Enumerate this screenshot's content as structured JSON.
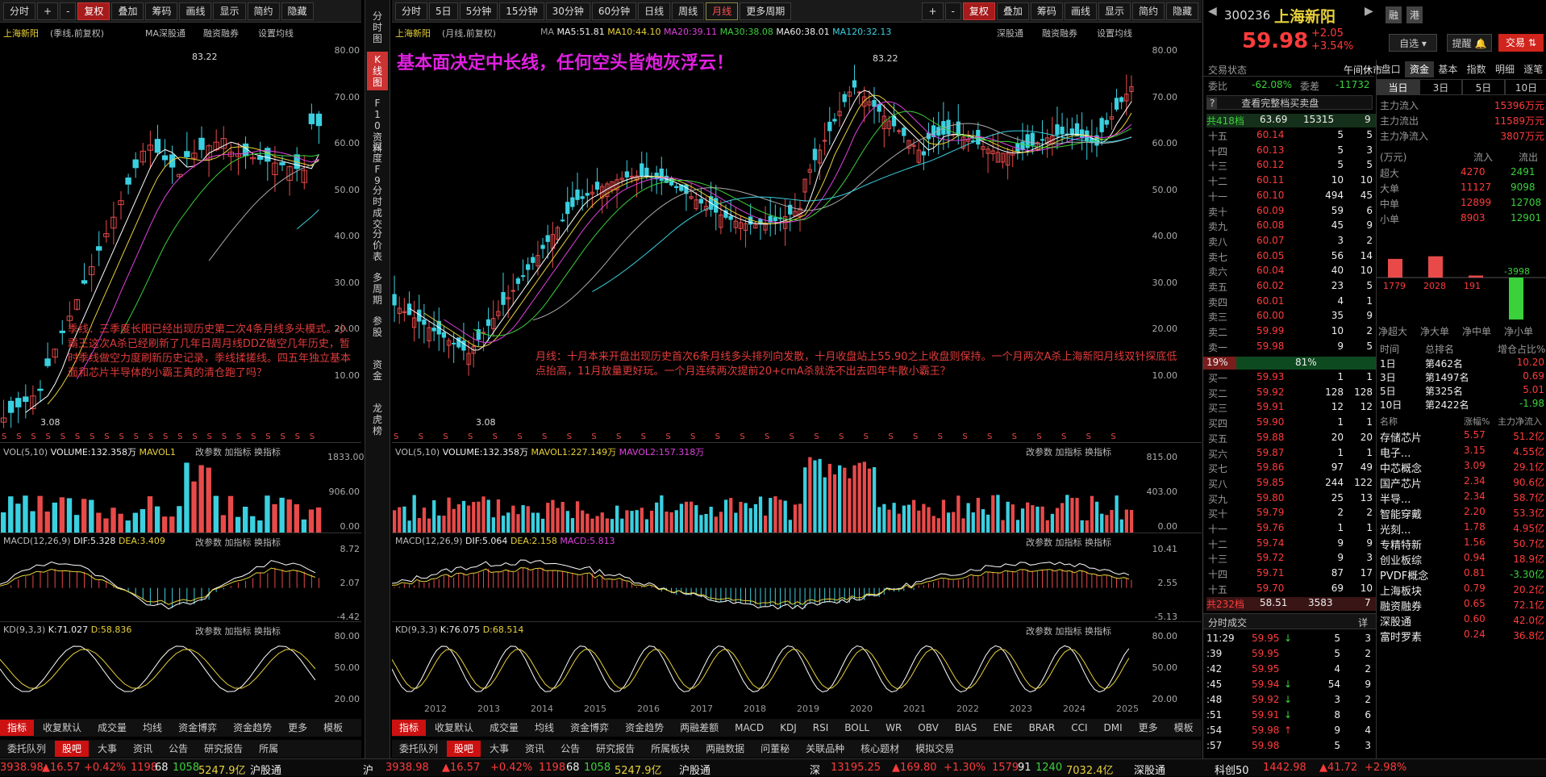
{
  "left": {
    "toolbar": [
      "分时",
      "+",
      "-",
      "复权",
      "叠加",
      "筹码",
      "画线",
      "显示",
      "简约",
      "隐藏"
    ],
    "title": "上海新阳",
    "period": "(季线,前复权)",
    "ma_label": "MA深股通",
    "financing": "融资融券",
    "settings": "设置均线",
    "yaxis": [
      "80.00",
      "70.00",
      "60.00",
      "50.00",
      "40.00",
      "30.00",
      "20.00",
      "10.00"
    ],
    "high": "83.22",
    "low": "3.08",
    "annot": "季线：三季度长阳已经出现历史第二次4条月线多头模式。小霸王这次A杀已经刷新了几年日周月线DDZ做空几年历史，暂时季线做空力度刷新历史记录，季线揉搓线。四五年独立基本面和芯片半导体的小霸王真的清仓跑了吗？",
    "vol": {
      "label": "VOL(5,10)",
      "v": "VOLUME:132.358万",
      "ma": "MAVOL1",
      "tools": [
        "改参数",
        "加指标",
        "换指标"
      ],
      "yaxis": [
        "1833.00",
        "906.00",
        "0.00"
      ]
    },
    "macd": {
      "label": "MACD(12,26,9)",
      "dif": "DIF:5.328",
      "dea": "DEA:3.409",
      "tools": [
        "改参数",
        "加指标",
        "换指标"
      ],
      "yaxis": [
        "8.72",
        "2.07",
        "-4.42"
      ]
    },
    "kd": {
      "label": "KD(9,3,3)",
      "k": "K:71.027",
      "d": "D:58.836",
      "tools": [
        "改参数",
        "加指标",
        "换指标"
      ],
      "yaxis": [
        "80.00",
        "50.00",
        "20.00"
      ]
    },
    "ind_tabs": [
      "指标",
      "收复默认",
      "成交量",
      "均线",
      "资金博弈",
      "资金趋势",
      "更多",
      "模板"
    ],
    "bottom_tabs": [
      "委托队列",
      "股吧",
      "大事",
      "资讯",
      "公告",
      "研究报告",
      "所属"
    ]
  },
  "vtabs": [
    "分时图",
    "K线图",
    "F10资料",
    "深度F9",
    "分时成交",
    "分价表",
    "多周期",
    "参股",
    "资金",
    "龙虎榜"
  ],
  "main": {
    "toolbar": [
      "分时",
      "5日",
      "5分钟",
      "15分钟",
      "30分钟",
      "60分钟",
      "日线",
      "周线",
      "月线",
      "更多周期"
    ],
    "tools": [
      "+",
      "-",
      "复权",
      "叠加",
      "筹码",
      "画线",
      "显示",
      "简约",
      "隐藏"
    ],
    "title": "上海新阳",
    "period": "(月线,前复权)",
    "ma": {
      "label": "MA",
      "ma5": "MA5:51.81",
      "ma10": "MA10:44.10",
      "ma20": "MA20:39.11",
      "ma30": "MA30:38.08",
      "ma60": "MA60:38.01",
      "ma120": "MA120:32.13"
    },
    "sg": "深股通",
    "financing": "融资融券",
    "settings": "设置均线",
    "headline": "基本面决定中长线，任何空头皆炮灰浮云！",
    "annot": "月线：十月本来开盘出现历史首次6条月线多头排列向发散，十月收盘站上55.90之上收盘则保持。一个月两次A杀上海新阳月线双针探底低点抬高，11月放量更好玩。一个月连续两次提前20+cmA杀就洗不出去四年牛散小霸王？",
    "high": "83.22",
    "low": "3.08",
    "yaxis": [
      "80.00",
      "70.00",
      "60.00",
      "50.00",
      "40.00",
      "30.00",
      "20.00",
      "10.00"
    ],
    "vol": {
      "label": "VOL(5,10)",
      "v": "VOLUME:132.358万",
      "ma1": "MAVOL1:227.149万",
      "ma2": "MAVOL2:157.318万",
      "tools": [
        "改参数",
        "加指标",
        "换指标"
      ],
      "yaxis": [
        "815.00",
        "403.00",
        "0.00"
      ]
    },
    "macd": {
      "label": "MACD(12,26,9)",
      "dif": "DIF:5.064",
      "dea": "DEA:2.158",
      "macd": "MACD:5.813",
      "tools": [
        "改参数",
        "加指标",
        "换指标"
      ],
      "yaxis": [
        "10.41",
        "2.55",
        "-5.13"
      ]
    },
    "kd": {
      "label": "KD(9,3,3)",
      "k": "K:76.075",
      "d": "D:68.514",
      "tools": [
        "改参数",
        "加指标",
        "换指标"
      ],
      "yaxis": [
        "80.00",
        "50.00",
        "20.00"
      ]
    },
    "years": [
      "2012",
      "2013",
      "2014",
      "2015",
      "2016",
      "2017",
      "2018",
      "2019",
      "2020",
      "2021",
      "2022",
      "2023",
      "2024",
      "2025"
    ],
    "ind_tabs": [
      "指标",
      "收复默认",
      "成交量",
      "均线",
      "资金博弈",
      "资金趋势",
      "两融差额",
      "MACD",
      "KDJ",
      "RSI",
      "BOLL",
      "WR",
      "OBV",
      "BIAS",
      "ENE",
      "BRAR",
      "CCI",
      "DMI",
      "更多",
      "模板"
    ],
    "bottom_tabs": [
      "委托队列",
      "股吧",
      "大事",
      "资讯",
      "公告",
      "研究报告",
      "所属板块",
      "两融数据",
      "问董秘",
      "关联品种",
      "核心题材",
      "模拟交易"
    ]
  },
  "quote": {
    "code": "300236",
    "name": "上海新阳",
    "tags": [
      "融",
      "港"
    ],
    "price": "59.98",
    "chg": "+2.05",
    "pct": "+3.54%",
    "btns": [
      "自选",
      "提醒",
      "交易"
    ],
    "status_label": "交易状态",
    "status": "午间休市",
    "wb_label": "委比",
    "wb": "-62.08%",
    "wc_label": "委差",
    "wc": "-11732",
    "full_book": "查看完整档买卖盘",
    "total_sell": {
      "label": "共418档",
      "price": "63.69",
      "vol": "15315",
      "n": "9"
    },
    "asks": [
      [
        "十五",
        "60.14",
        "5",
        "5"
      ],
      [
        "十四",
        "60.13",
        "5",
        "3"
      ],
      [
        "十三",
        "60.12",
        "5",
        "5"
      ],
      [
        "十二",
        "60.11",
        "10",
        "10"
      ],
      [
        "十一",
        "60.10",
        "494",
        "45"
      ],
      [
        "卖十",
        "60.09",
        "59",
        "6"
      ],
      [
        "卖九",
        "60.08",
        "45",
        "9"
      ],
      [
        "卖八",
        "60.07",
        "3",
        "2"
      ],
      [
        "卖七",
        "60.05",
        "56",
        "14"
      ],
      [
        "卖六",
        "60.04",
        "40",
        "10"
      ],
      [
        "卖五",
        "60.02",
        "23",
        "5"
      ],
      [
        "卖四",
        "60.01",
        "4",
        "1"
      ],
      [
        "卖三",
        "60.00",
        "35",
        "9"
      ],
      [
        "卖二",
        "59.99",
        "10",
        "2"
      ],
      [
        "卖一",
        "59.98",
        "9",
        "5"
      ]
    ],
    "ratio": {
      "l": "19%",
      "r": "81%"
    },
    "bids": [
      [
        "买一",
        "59.93",
        "1",
        "1"
      ],
      [
        "买二",
        "59.92",
        "128",
        "128"
      ],
      [
        "买三",
        "59.91",
        "12",
        "12"
      ],
      [
        "买四",
        "59.90",
        "1",
        "1"
      ],
      [
        "买五",
        "59.88",
        "20",
        "20"
      ],
      [
        "买六",
        "59.87",
        "1",
        "1"
      ],
      [
        "买七",
        "59.86",
        "97",
        "49"
      ],
      [
        "买八",
        "59.85",
        "244",
        "122"
      ],
      [
        "买九",
        "59.80",
        "25",
        "13"
      ],
      [
        "买十",
        "59.79",
        "2",
        "2"
      ],
      [
        "十一",
        "59.76",
        "1",
        "1"
      ],
      [
        "十二",
        "59.74",
        "9",
        "9"
      ],
      [
        "十三",
        "59.72",
        "9",
        "3"
      ],
      [
        "十四",
        "59.71",
        "87",
        "17"
      ],
      [
        "十五",
        "59.70",
        "69",
        "10"
      ]
    ],
    "total_buy": {
      "label": "共232档",
      "price": "58.51",
      "vol": "3583",
      "n": "7"
    },
    "ticks_title": "分时成交",
    "ticks_more": "详",
    "ticks": [
      [
        "11:29",
        "59.95",
        "↓",
        "5",
        "3"
      ],
      [
        ":39",
        "59.95",
        "",
        "5",
        "2"
      ],
      [
        ":42",
        "59.95",
        "",
        "4",
        "2"
      ],
      [
        ":45",
        "59.94",
        "↓",
        "54",
        "9"
      ],
      [
        ":48",
        "59.92",
        "↓",
        "3",
        "2"
      ],
      [
        ":51",
        "59.91",
        "↓",
        "8",
        "6"
      ],
      [
        ":54",
        "59.98",
        "↑",
        "9",
        "4"
      ],
      [
        ":57",
        "59.98",
        "",
        "5",
        "3"
      ]
    ]
  },
  "fund": {
    "tabs": [
      "盘口",
      "资金",
      "基本",
      "指数",
      "明细",
      "逐笔"
    ],
    "periods": [
      "当日",
      "3日",
      "5日",
      "10日"
    ],
    "flows": [
      [
        "主力流入",
        "15396万元"
      ],
      [
        "主力流出",
        "11589万元"
      ],
      [
        "主力净流入",
        "3807万元"
      ]
    ],
    "table_head": [
      "(万元)",
      "流入",
      "流出"
    ],
    "table": [
      [
        "超大",
        "4270",
        "2491"
      ],
      [
        "大单",
        "11127",
        "9098"
      ],
      [
        "中单",
        "12899",
        "12708"
      ],
      [
        "小单",
        "8903",
        "12901"
      ]
    ],
    "net_labels": [
      "净超大",
      "净大单",
      "净中单",
      "净小单"
    ],
    "net_values": [
      1779,
      2028,
      191,
      -3998
    ],
    "rank_head": [
      "时间",
      "总排名",
      "增仓占比%"
    ],
    "ranks": [
      [
        "1日",
        "第462名",
        "10.20"
      ],
      [
        "3日",
        "第1497名",
        "0.69"
      ],
      [
        "5日",
        "第325名",
        "5.01"
      ],
      [
        "10日",
        "第2422名",
        "-1.98"
      ]
    ],
    "sector_head": [
      "名称",
      "涨幅%",
      "主力净流入"
    ],
    "sectors": [
      [
        "存储芯片",
        "5.57",
        "51.2亿"
      ],
      [
        "电子...",
        "3.15",
        "4.55亿"
      ],
      [
        "中芯概念",
        "3.09",
        "29.1亿"
      ],
      [
        "国产芯片",
        "2.34",
        "90.6亿"
      ],
      [
        "半导...",
        "2.34",
        "58.7亿"
      ],
      [
        "智能穿戴",
        "2.20",
        "53.3亿"
      ],
      [
        "光刻...",
        "1.78",
        "4.95亿"
      ],
      [
        "专精特新",
        "1.56",
        "50.7亿"
      ],
      [
        "创业板综",
        "0.94",
        "18.9亿"
      ],
      [
        "PVDF概念",
        "0.81",
        "-3.30亿"
      ],
      [
        "上海板块",
        "0.79",
        "20.2亿"
      ],
      [
        "融资融券",
        "0.65",
        "72.1亿"
      ],
      [
        "深股通",
        "0.60",
        "42.0亿"
      ],
      [
        "富时罗素",
        "0.24",
        "36.8亿"
      ]
    ]
  },
  "status": {
    "left": "3938.98 ▲16.57 +0.42% 1198 68 1058 5247.9亿 沪股通",
    "sh": "沪",
    "sh_idx": "3938.98",
    "sh_chg": "▲16.57",
    "sh_pct": "+0.42%",
    "sh_a": "1198",
    "sh_b": "68",
    "sh_c": "1058",
    "sh_amt": "5247.9亿",
    "hgt": "沪股通",
    "sz": "深",
    "sz_idx": "13195.25",
    "sz_chg": "▲169.80",
    "sz_pct": "+1.30%",
    "sz_a": "1579",
    "sz_b": "91",
    "sz_c": "1240",
    "sz_amt": "7032.4亿",
    "sgt": "深股通",
    "kc": "科创50",
    "kc_idx": "1442.98",
    "kc_chg": "▲41.72",
    "kc_pct": "+2.98%"
  }
}
